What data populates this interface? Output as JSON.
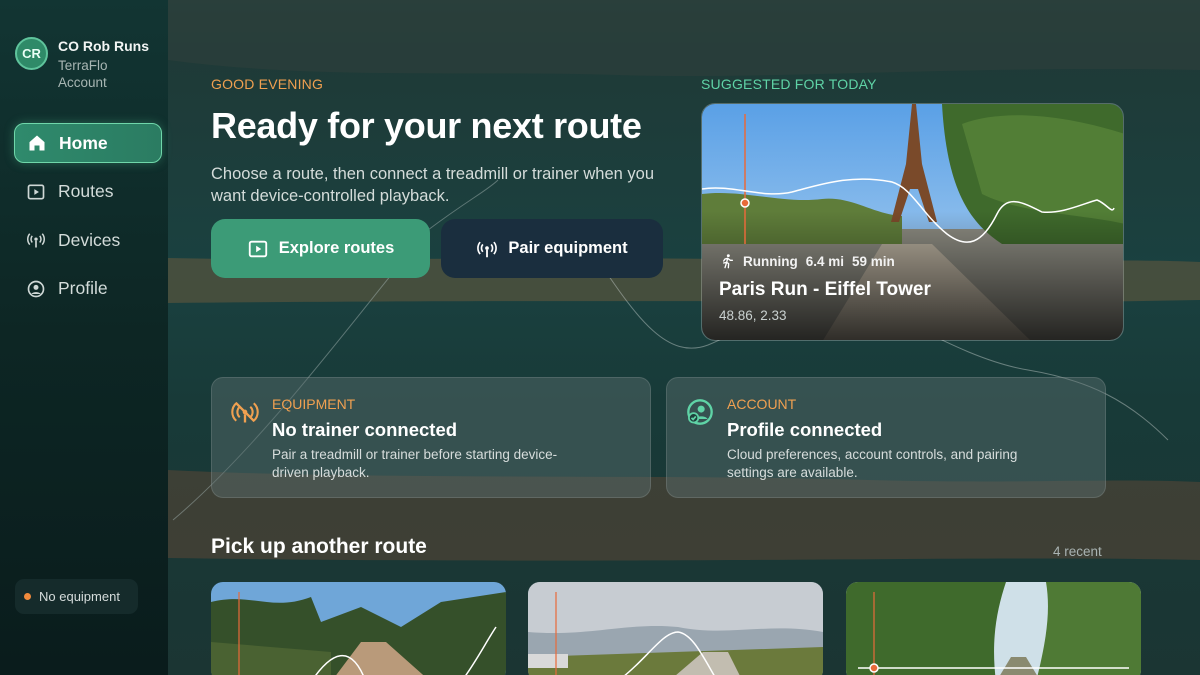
{
  "user": {
    "initials": "CR",
    "name": "CO Rob Runs",
    "subtitle": "TerraFlo Account"
  },
  "nav": [
    {
      "label": "Home",
      "icon": "home-icon",
      "active": true
    },
    {
      "label": "Routes",
      "icon": "play-square-icon",
      "active": false
    },
    {
      "label": "Devices",
      "icon": "antenna-icon",
      "active": false
    },
    {
      "label": "Profile",
      "icon": "profile-circle-icon",
      "active": false
    }
  ],
  "equipment_status": "No equipment",
  "hero": {
    "greeting": "GOOD EVENING",
    "title": "Ready for your next route",
    "subtitle": "Choose a route, then connect a treadmill or trainer when you want device-controlled playback.",
    "primary_button": "Explore routes",
    "secondary_button": "Pair equipment"
  },
  "suggested": {
    "label": "SUGGESTED FOR TODAY",
    "activity": "Running",
    "distance": "6.4 mi",
    "duration": "59 min",
    "title": "Paris Run - Eiffel Tower",
    "coords": "48.86, 2.33"
  },
  "status_cards": [
    {
      "kicker": "EQUIPMENT",
      "title": "No trainer connected",
      "desc": "Pair a treadmill or trainer before starting device-driven playback."
    },
    {
      "kicker": "ACCOUNT",
      "title": "Profile connected",
      "desc": "Cloud preferences, account controls, and pairing settings are available."
    }
  ],
  "recent": {
    "title": "Pick up another route",
    "count": "4 recent"
  },
  "colors": {
    "accent_green": "#3c9b77",
    "accent_orange": "#f0a050",
    "accent_teal": "#5fd3a6"
  }
}
